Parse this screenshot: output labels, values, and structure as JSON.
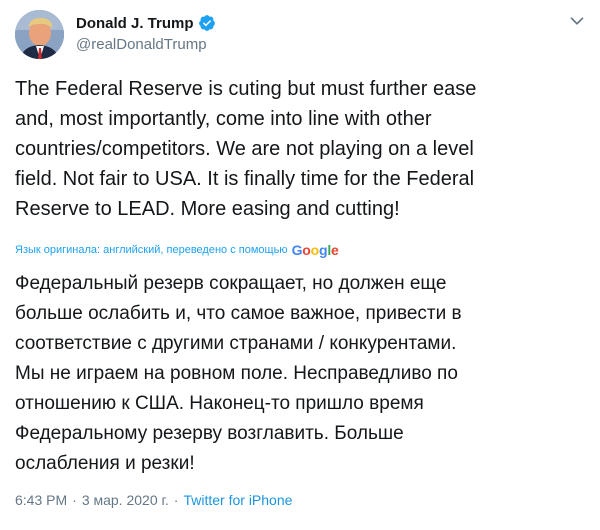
{
  "user": {
    "display_name": "Donald J. Trump",
    "handle": "@realDonaldTrump",
    "verified": true
  },
  "tweet": {
    "text": "The Federal Reserve is cuting  but must further ease\nand, most importantly, come into line with other\ncountries/competitors. We are not playing on a level\nfield. Not fair to USA. It is finally time for the Federal\nReserve to LEAD. More easing and cutting!"
  },
  "translation": {
    "note": "Язык оригинала: английский, переведено с помощью",
    "provider": "Google",
    "text": "Федеральный резерв сокращает, но должен еще\nбольше ослабить и, что самое важное, привести в\nсоответствие с другими странами / конкурентами.\nМы не играем на ровном поле. Несправедливо по\nотношению к США. Наконец-то пришло время\nФедеральному резерву возглавить. Больше\nослабления и резки!"
  },
  "meta": {
    "time": "6:43 PM",
    "date": "3 мар. 2020 г.",
    "separator": "·",
    "source": "Twitter for iPhone"
  },
  "icons": {
    "verified": "verified-badge-icon",
    "caret": "chevron-down-icon"
  },
  "colors": {
    "link": "#1da1f2",
    "secondary_text": "#657786",
    "text": "#14171a"
  }
}
